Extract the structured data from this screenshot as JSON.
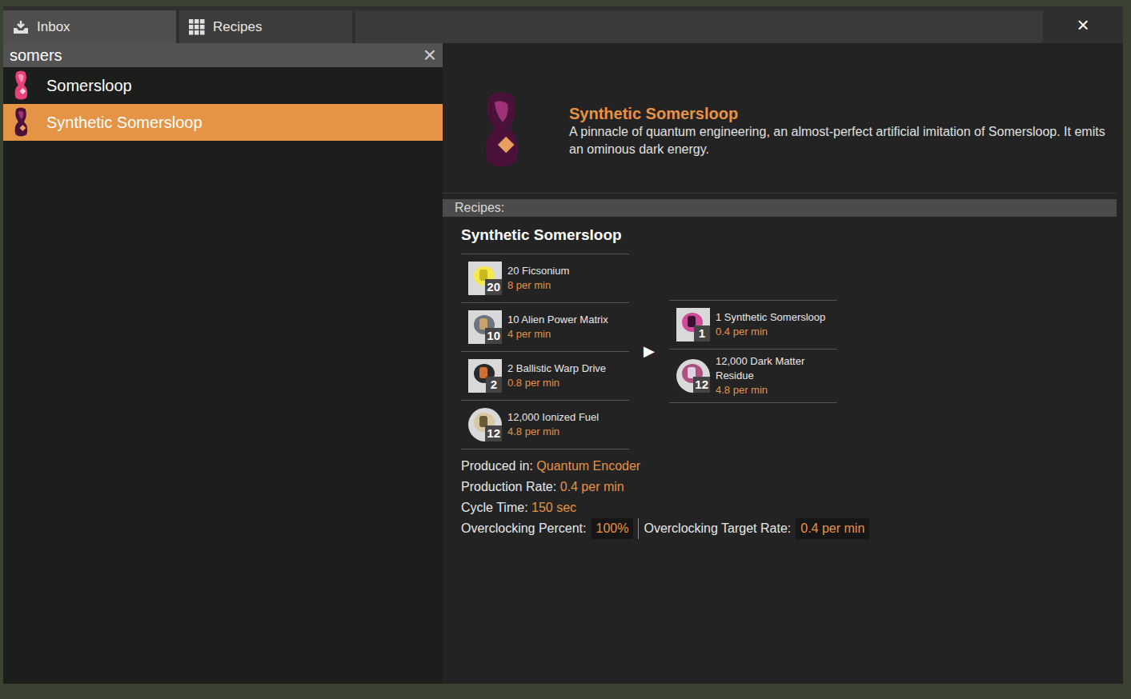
{
  "tabs": [
    {
      "label": "Inbox",
      "selected": false
    },
    {
      "label": "Recipes",
      "selected": true
    }
  ],
  "close_button": "×",
  "search": {
    "value": "somers",
    "clear": "×"
  },
  "results": [
    {
      "label": "Somersloop",
      "selected": false
    },
    {
      "label": "Synthetic Somersloop",
      "selected": true
    }
  ],
  "item": {
    "name": "Synthetic Somersloop",
    "description": "A pinnacle of quantum engineering, an almost-perfect artificial imitation of Somersloop. It emits an ominous dark energy."
  },
  "recipes_header": "Recipes:",
  "recipe": {
    "name": "Synthetic Somersloop",
    "arrow": "▶",
    "ingredients": [
      {
        "count": "20",
        "name": "20 Ficsonium",
        "rate": "8 per min"
      },
      {
        "count": "10",
        "name": "10 Alien Power Matrix",
        "rate": "4 per min"
      },
      {
        "count": "2",
        "name": "2 Ballistic Warp Drive",
        "rate": "0.8 per min"
      },
      {
        "count": "12",
        "name": "12,000 Ionized Fuel",
        "rate": "4.8 per min"
      }
    ],
    "products": [
      {
        "count": "1",
        "name": "1 Synthetic Somersloop",
        "rate": "0.4 per min"
      },
      {
        "count": "12",
        "name": "12,000 Dark Matter Residue",
        "rate": "4.8 per min"
      }
    ],
    "details": [
      {
        "label": "Produced in:",
        "value": "Quantum Encoder"
      },
      {
        "label": "Production Rate:",
        "value": "0.4 per min"
      },
      {
        "label": "Cycle Time:",
        "value": "150 sec"
      }
    ],
    "overclock": [
      {
        "label": "Overclocking Percent:",
        "value": "100%"
      },
      {
        "label": "Overclocking Target Rate:",
        "value": "0.4 per min"
      }
    ]
  }
}
